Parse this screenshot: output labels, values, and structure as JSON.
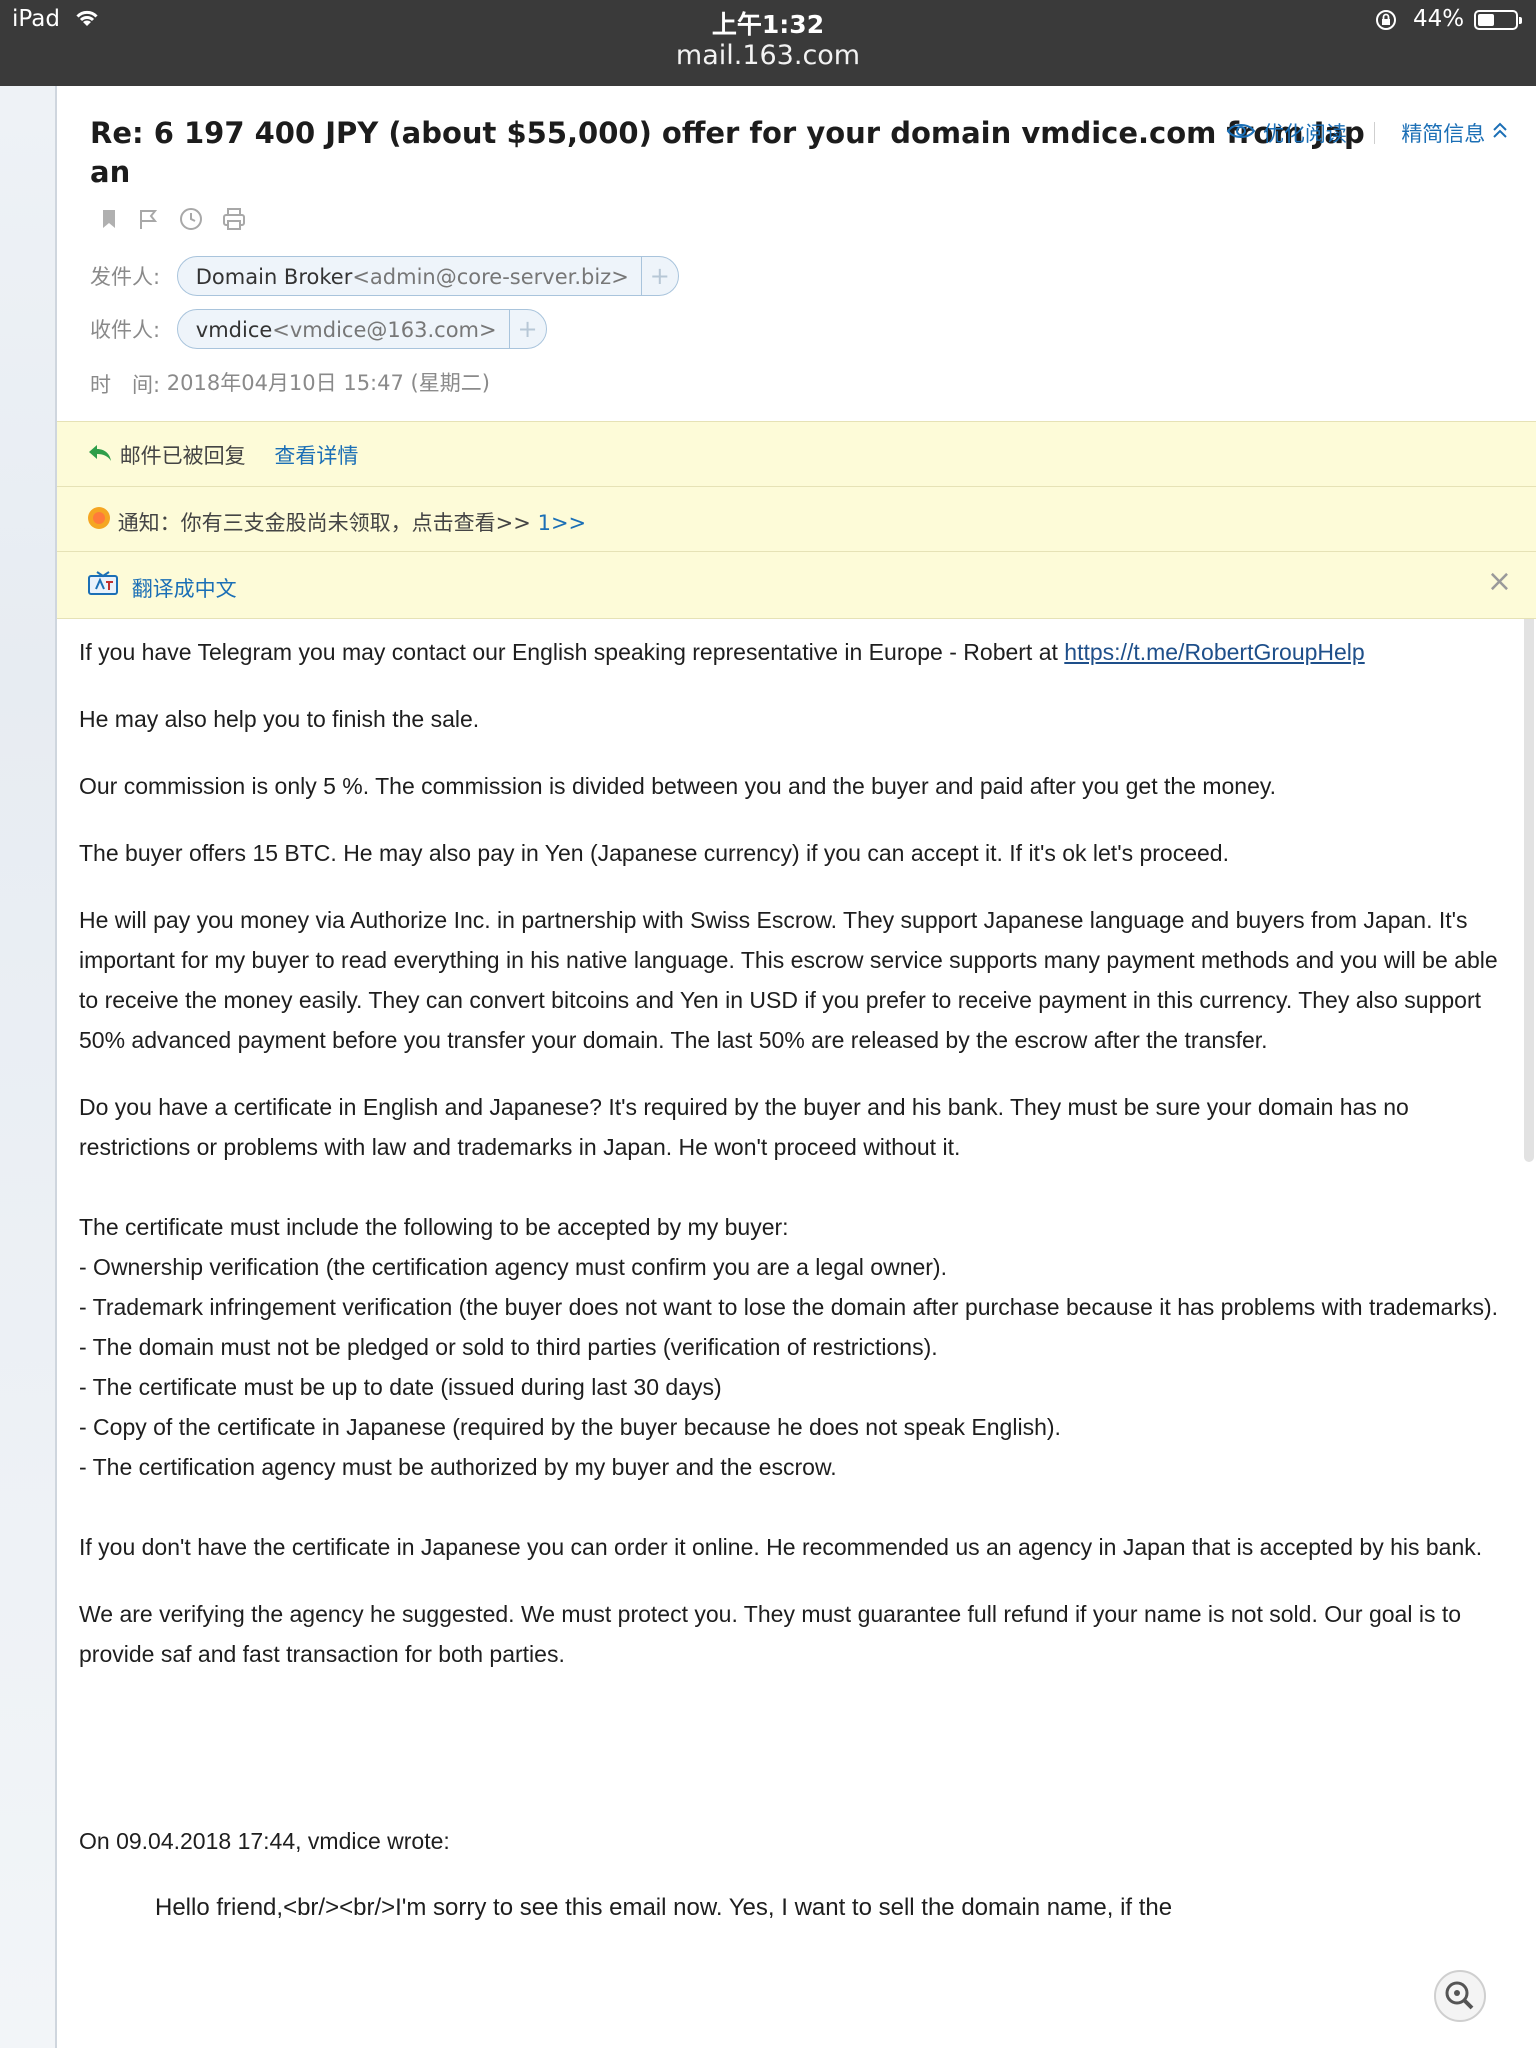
{
  "status_bar": {
    "device": "iPad",
    "time": "上午1:32",
    "url": "mail.163.com",
    "battery_pct": "44%",
    "battery_level": 0.44
  },
  "header": {
    "subject": "Re: 6 197 400 JPY (about $55,000) offer for your domain vmdice.com from Japan",
    "optimized_read": "优化阅读",
    "brief_info": "精简信息",
    "from_label": "发件人:",
    "from_name": "Domain Broker",
    "from_addr": "<admin@core-server.biz>",
    "to_label": "收件人:",
    "to_name": "vmdice",
    "to_addr": "<vmdice@163.com>",
    "time_label": "时　间:",
    "time_value": "2018年04月10日 15:47 (星期二)",
    "add": "+"
  },
  "notices": {
    "replied": "邮件已被回复",
    "view_details": "查看详情",
    "notice_text": "通知：你有三支金股尚未领取，点击查看>>",
    "notice_link": "1>>",
    "translate": "翻译成中文",
    "close": "×"
  },
  "body": {
    "p1_text": "If you have Telegram you may contact our English speaking representative in Europe - Robert at ",
    "p1_link": "https://t.me/RobertGroupHelp",
    "p2": "He may also help you to finish the sale.",
    "p3": "Our commission is only 5 %. The commission is divided between you and the buyer and paid after you get the money.",
    "p4": "The buyer offers 15 BTC. He may also pay in Yen (Japanese currency) if you can accept it. If it's ok let's proceed.",
    "p5": "He will pay you money via Authorize Inc. in partnership with Swiss Escrow. They support Japanese language and buyers from Japan. It's important for my buyer to read everything in his native language. This escrow service supports many payment methods and you will be able to receive the money easily. They can convert bitcoins and Yen in USD if you prefer to receive payment in this currency. They also support 50% advanced payment before you transfer your domain. The last 50% are released by the escrow after the transfer.",
    "p6": "Do you have a certificate in English and Japanese? It's required by the buyer and his bank. They must be sure your domain has no restrictions or problems with law and trademarks in Japan. He won't proceed without it.",
    "list_intro": "The certificate must include the following to be accepted by my buyer:",
    "list": [
      "- Ownership verification (the certification agency must confirm you are a legal owner).",
      "- Trademark infringement verification (the buyer does not want to lose the domain after purchase because it has problems with trademarks).",
      "- The domain must not be pledged or sold to third parties (verification of restrictions).",
      "- The certificate must be up to date (issued during last 30 days)",
      "- Copy of the certificate in Japanese (required by the buyer because he does not speak English).",
      "- The certification agency must be authorized by my buyer and the escrow."
    ],
    "p7": "If you don't have the certificate in Japanese you can order it online. He recommended us an agency in Japan that is accepted by his bank.",
    "p8": "We are verifying the agency he suggested. We must protect you. They must guarantee full refund if your name is not sold. Our goal is to provide saf and fast transaction for both parties.",
    "quote_header": "On 09.04.2018 17:44, vmdice wrote:",
    "quote_text": "Hello friend,<br/><br/>I'm sorry to see this email now. Yes, I want to sell the domain name, if the"
  },
  "colors": {
    "status_bar": "#3a3a3a",
    "link_blue": "#1b6fb6",
    "notice_bg": "#fdfbd8"
  }
}
